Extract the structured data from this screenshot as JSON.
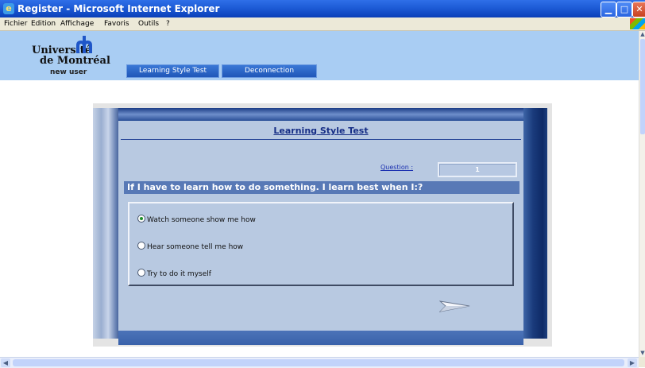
{
  "window": {
    "title": "Register - Microsoft Internet Explorer",
    "icon": "ie-icon",
    "controls": [
      "minimize-icon",
      "maximize-icon",
      "close-icon"
    ]
  },
  "menu": {
    "items": [
      "Fichier",
      "Edition",
      "Affichage",
      "Favoris",
      "Outils",
      "?"
    ]
  },
  "header": {
    "logo_line1": "Université",
    "logo_line2": "de Montréal",
    "user_label": "new user",
    "nav": [
      "Learning Style Test",
      "Deconnection"
    ],
    "band_color": "#a9cdf3"
  },
  "quiz": {
    "heading": "Learning Style Test",
    "question_label": "Question :",
    "question_number": "1",
    "question_text": "If I have to learn how to do something. I learn best when I:?",
    "options": [
      {
        "label": "Watch someone show me how",
        "checked": true
      },
      {
        "label": "Hear someone tell me how",
        "checked": false
      },
      {
        "label": "Try to do it myself",
        "checked": false
      }
    ],
    "next_icon": "arrow-right-icon"
  },
  "colors": {
    "accent": "#1f56b8",
    "panel_bg": "#b8c9e1",
    "question_bar": "#5879b6"
  }
}
